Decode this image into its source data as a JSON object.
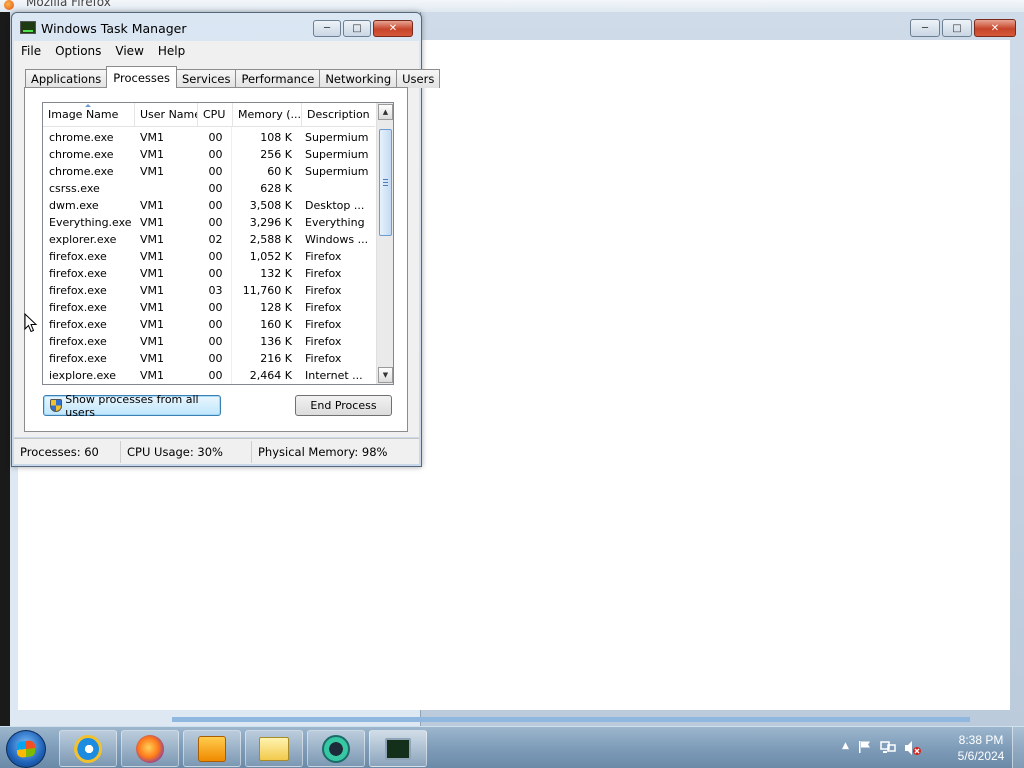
{
  "background_window": {
    "title": "Mozilla Firefox"
  },
  "task_manager": {
    "title": "Windows Task Manager",
    "menu": [
      "File",
      "Options",
      "View",
      "Help"
    ],
    "tabs": [
      "Applications",
      "Processes",
      "Services",
      "Performance",
      "Networking",
      "Users"
    ],
    "active_tab": "Processes",
    "columns": [
      "Image Name",
      "User Name",
      "CPU",
      "Memory (...",
      "Description"
    ],
    "processes": [
      {
        "image": "chrome.exe",
        "user": "VM1",
        "cpu": "00",
        "memory": "108 K",
        "description": "Supermium"
      },
      {
        "image": "chrome.exe",
        "user": "VM1",
        "cpu": "00",
        "memory": "256 K",
        "description": "Supermium"
      },
      {
        "image": "chrome.exe",
        "user": "VM1",
        "cpu": "00",
        "memory": "60 K",
        "description": "Supermium"
      },
      {
        "image": "csrss.exe",
        "user": "",
        "cpu": "00",
        "memory": "628 K",
        "description": ""
      },
      {
        "image": "dwm.exe",
        "user": "VM1",
        "cpu": "00",
        "memory": "3,508 K",
        "description": "Desktop ..."
      },
      {
        "image": "Everything.exe",
        "user": "VM1",
        "cpu": "00",
        "memory": "3,296 K",
        "description": "Everything"
      },
      {
        "image": "explorer.exe",
        "user": "VM1",
        "cpu": "02",
        "memory": "2,588 K",
        "description": "Windows ..."
      },
      {
        "image": "firefox.exe",
        "user": "VM1",
        "cpu": "00",
        "memory": "1,052 K",
        "description": "Firefox"
      },
      {
        "image": "firefox.exe",
        "user": "VM1",
        "cpu": "00",
        "memory": "132 K",
        "description": "Firefox"
      },
      {
        "image": "firefox.exe",
        "user": "VM1",
        "cpu": "03",
        "memory": "11,760 K",
        "description": "Firefox"
      },
      {
        "image": "firefox.exe",
        "user": "VM1",
        "cpu": "00",
        "memory": "128 K",
        "description": "Firefox"
      },
      {
        "image": "firefox.exe",
        "user": "VM1",
        "cpu": "00",
        "memory": "160 K",
        "description": "Firefox"
      },
      {
        "image": "firefox.exe",
        "user": "VM1",
        "cpu": "00",
        "memory": "136 K",
        "description": "Firefox"
      },
      {
        "image": "firefox.exe",
        "user": "VM1",
        "cpu": "00",
        "memory": "216 K",
        "description": "Firefox"
      },
      {
        "image": "iexplore.exe",
        "user": "VM1",
        "cpu": "00",
        "memory": "2,464 K",
        "description": "Internet ..."
      }
    ],
    "buttons": {
      "show_all": "Show processes from all users",
      "end_process": "End Process"
    },
    "status": {
      "processes": "Processes: 60",
      "cpu_usage": "CPU Usage: 30%",
      "physical_memory": "Physical Memory: 98%"
    }
  },
  "taskbar": {
    "items": [
      "internet-explorer-icon",
      "firefox-icon",
      "media-player-icon",
      "windows-explorer-icon",
      "app-icon",
      "task-manager-icon"
    ],
    "clock": {
      "time": "8:38 PM",
      "date": "5/6/2024"
    }
  },
  "colors": {
    "taskbar": "#7f9db9",
    "close_button": "#c7452a",
    "selected_button": "#bee6fd"
  }
}
